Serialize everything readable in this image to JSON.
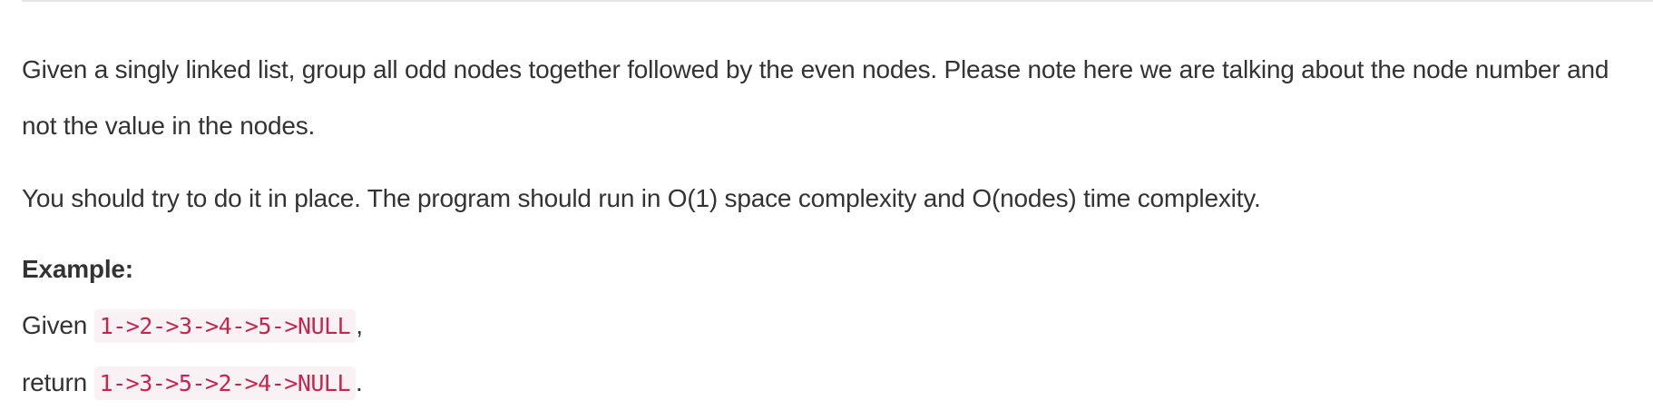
{
  "problem": {
    "paragraph_1": "Given a singly linked list, group all odd nodes together followed by the even nodes. Please note here we are talking about the node number and not the value in the nodes.",
    "paragraph_2": "You should try to do it in place. The program should run in O(1) space complexity and O(nodes) time complexity.",
    "example_heading": "Example:",
    "example": {
      "given_label": "Given",
      "given_code": "1->2->3->4->5->NULL",
      "given_suffix": ",",
      "return_label": "return",
      "return_code": "1->3->5->2->4->NULL",
      "return_suffix": "."
    }
  }
}
